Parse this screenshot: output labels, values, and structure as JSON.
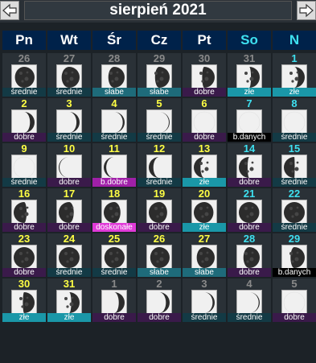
{
  "header": {
    "title": "sierpień 2021"
  },
  "weekdays": [
    {
      "label": "Pn",
      "weekend": false
    },
    {
      "label": "Wt",
      "weekend": false
    },
    {
      "label": "Śr",
      "weekend": false
    },
    {
      "label": "Cz",
      "weekend": false
    },
    {
      "label": "Pt",
      "weekend": false
    },
    {
      "label": "So",
      "weekend": true
    },
    {
      "label": "N",
      "weekend": true
    }
  ],
  "colors": {
    "dobre": "#3a1a4a",
    "srednie": "#133a45",
    "slabe": "#1e6b7a",
    "zle": "#1a97a8",
    "b.dobre": "#a020a8",
    "doskonale": "#e03ad8",
    "b.danych": "#000000"
  },
  "days": [
    {
      "day": "26",
      "month": "prev",
      "phase": 0.94,
      "rating": "średnie",
      "class": "srednie"
    },
    {
      "day": "27",
      "month": "prev",
      "phase": 0.86,
      "rating": "średnie",
      "class": "srednie"
    },
    {
      "day": "28",
      "month": "prev",
      "phase": 0.78,
      "rating": "słabe",
      "class": "slabe"
    },
    {
      "day": "29",
      "month": "prev",
      "phase": 0.7,
      "rating": "słabe",
      "class": "slabe"
    },
    {
      "day": "30",
      "month": "prev",
      "phase": 0.6,
      "rating": "dobre",
      "class": "dobre"
    },
    {
      "day": "31",
      "month": "prev",
      "phase": 0.42,
      "rating": "złe",
      "class": "zle"
    },
    {
      "day": "1",
      "month": "cur",
      "phase": 0.32,
      "rating": "złe",
      "class": "zle"
    },
    {
      "day": "2",
      "month": "cur",
      "phase": 0.22,
      "rating": "dobre",
      "class": "dobre"
    },
    {
      "day": "3",
      "month": "cur",
      "phase": 0.15,
      "rating": "średnie",
      "class": "srednie"
    },
    {
      "day": "4",
      "month": "cur",
      "phase": 0.09,
      "rating": "średnie",
      "class": "srednie"
    },
    {
      "day": "5",
      "month": "cur",
      "phase": 0.04,
      "rating": "średnie",
      "class": "srednie"
    },
    {
      "day": "6",
      "month": "cur",
      "phase": 0.0,
      "rating": "dobre",
      "class": "dobre"
    },
    {
      "day": "7",
      "month": "cur",
      "phase": 0.0,
      "rating": "b.danych",
      "class": "b.danych"
    },
    {
      "day": "8",
      "month": "cur",
      "phase": 0.0,
      "rating": "średnie",
      "class": "srednie"
    },
    {
      "day": "9",
      "month": "cur",
      "phase": 0.0,
      "rating": "średnie",
      "class": "srednie"
    },
    {
      "day": "10",
      "month": "cur",
      "phase": -0.04,
      "rating": "dobre",
      "class": "dobre"
    },
    {
      "day": "11",
      "month": "cur",
      "phase": -0.12,
      "rating": "b.dobre",
      "class": "b.dobre"
    },
    {
      "day": "12",
      "month": "cur",
      "phase": -0.22,
      "rating": "średnie",
      "class": "srednie"
    },
    {
      "day": "13",
      "month": "cur",
      "phase": -0.32,
      "rating": "złe",
      "class": "zle"
    },
    {
      "day": "14",
      "month": "cur",
      "phase": -0.42,
      "rating": "dobre",
      "class": "dobre"
    },
    {
      "day": "15",
      "month": "cur",
      "phase": -0.52,
      "rating": "średnie",
      "class": "srednie"
    },
    {
      "day": "16",
      "month": "cur",
      "phase": -0.62,
      "rating": "dobre",
      "class": "dobre"
    },
    {
      "day": "17",
      "month": "cur",
      "phase": -0.72,
      "rating": "dobre",
      "class": "dobre"
    },
    {
      "day": "18",
      "month": "cur",
      "phase": -0.8,
      "rating": "doskonałe",
      "class": "doskonale"
    },
    {
      "day": "19",
      "month": "cur",
      "phase": -0.88,
      "rating": "dobre",
      "class": "dobre"
    },
    {
      "day": "20",
      "month": "cur",
      "phase": -0.94,
      "rating": "złe",
      "class": "zle"
    },
    {
      "day": "21",
      "month": "cur",
      "phase": -0.98,
      "rating": "dobre",
      "class": "dobre"
    },
    {
      "day": "22",
      "month": "cur",
      "phase": 1.0,
      "rating": "średnie",
      "class": "srednie"
    },
    {
      "day": "23",
      "month": "cur",
      "phase": 1.0,
      "rating": "dobre",
      "class": "dobre"
    },
    {
      "day": "24",
      "month": "cur",
      "phase": 0.99,
      "rating": "średnie",
      "class": "srednie"
    },
    {
      "day": "25",
      "month": "cur",
      "phase": 0.97,
      "rating": "średnie",
      "class": "srednie"
    },
    {
      "day": "26",
      "month": "cur",
      "phase": 0.93,
      "rating": "słabe",
      "class": "slabe"
    },
    {
      "day": "27",
      "month": "cur",
      "phase": 0.86,
      "rating": "słabe",
      "class": "slabe"
    },
    {
      "day": "28",
      "month": "cur",
      "phase": 0.78,
      "rating": "dobre",
      "class": "dobre"
    },
    {
      "day": "29",
      "month": "cur",
      "phase": 0.68,
      "rating": "b.danych",
      "class": "b.danych"
    },
    {
      "day": "30",
      "month": "cur",
      "phase": 0.56,
      "rating": "złe",
      "class": "zle"
    },
    {
      "day": "31",
      "month": "cur",
      "phase": 0.4,
      "rating": "złe",
      "class": "zle"
    },
    {
      "day": "1",
      "month": "next",
      "phase": 0.28,
      "rating": "dobre",
      "class": "dobre"
    },
    {
      "day": "2",
      "month": "next",
      "phase": 0.18,
      "rating": "dobre",
      "class": "dobre"
    },
    {
      "day": "3",
      "month": "next",
      "phase": 0.1,
      "rating": "średnie",
      "class": "srednie"
    },
    {
      "day": "4",
      "month": "next",
      "phase": 0.05,
      "rating": "średnie",
      "class": "srednie"
    },
    {
      "day": "5",
      "month": "next",
      "phase": 0.0,
      "rating": "dobre",
      "class": "dobre"
    }
  ]
}
